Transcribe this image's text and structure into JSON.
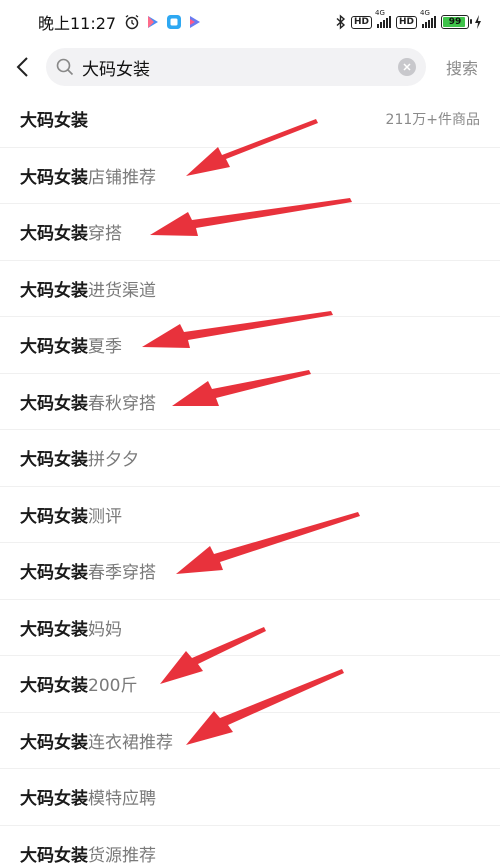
{
  "status_bar": {
    "time": "晚上11:27",
    "hd1": "HD",
    "lte1": "4G",
    "hd2": "HD",
    "lte2": "4G",
    "battery": "99"
  },
  "search": {
    "query": "大码女装",
    "button_label": "搜索"
  },
  "suggestions": [
    {
      "keyword": "大码女装",
      "suffix": "",
      "count": "211万+件商品"
    },
    {
      "keyword": "大码女装",
      "suffix": "店铺推荐"
    },
    {
      "keyword": "大码女装",
      "suffix": "穿搭"
    },
    {
      "keyword": "大码女装",
      "suffix": "进货渠道"
    },
    {
      "keyword": "大码女装",
      "suffix": "夏季"
    },
    {
      "keyword": "大码女装",
      "suffix": "春秋穿搭"
    },
    {
      "keyword": "大码女装",
      "suffix": "拼夕夕"
    },
    {
      "keyword": "大码女装",
      "suffix": "测评"
    },
    {
      "keyword": "大码女装",
      "suffix": "春季穿搭"
    },
    {
      "keyword": "大码女装",
      "suffix": "妈妈"
    },
    {
      "keyword": "大码女装",
      "suffix": "200斤"
    },
    {
      "keyword": "大码女装",
      "suffix": "连衣裙推荐"
    },
    {
      "keyword": "大码女装",
      "suffix": "模特应聘"
    },
    {
      "keyword": "大码女装",
      "suffix": "货源推荐"
    }
  ],
  "colors": {
    "arrow": "#e8323c",
    "battery": "#3fc34a"
  }
}
